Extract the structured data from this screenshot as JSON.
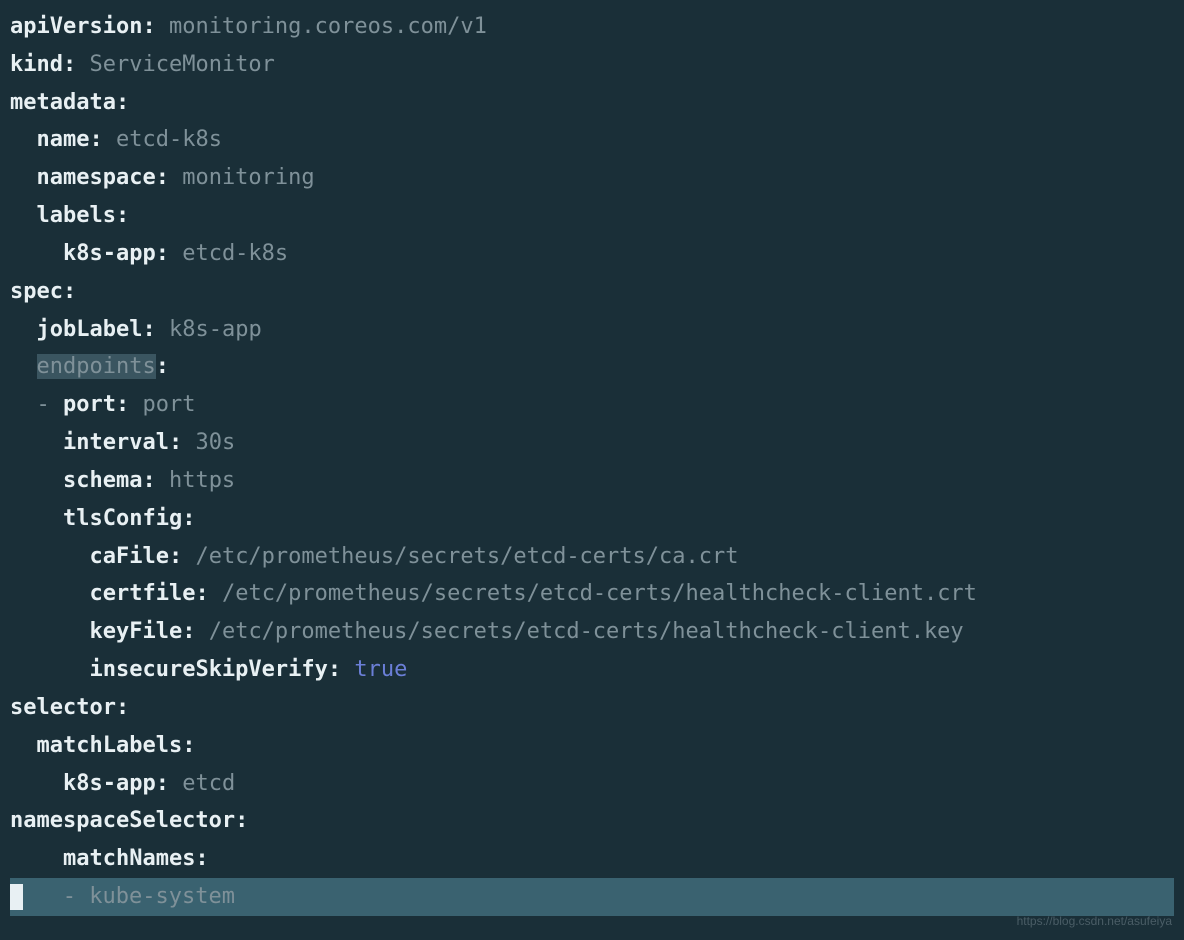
{
  "lines": {
    "l1_key": "apiVersion:",
    "l1_val": "monitoring.coreos.com/v1",
    "l2_key": "kind:",
    "l2_val": "ServiceMonitor",
    "l3_key": "metadata:",
    "l4_key": "name:",
    "l4_val": "etcd-k8s",
    "l5_key": "namespace:",
    "l5_val": "monitoring",
    "l6_key": "labels:",
    "l7_key": "k8s-app:",
    "l7_val": "etcd-k8s",
    "l8_key": "spec:",
    "l9_key": "jobLabel:",
    "l9_val": "k8s-app",
    "l10_hl": "endpoints",
    "l10_colon": ":",
    "l11_dash": "-",
    "l11_key": "port:",
    "l11_val": "port",
    "l12_key": "interval:",
    "l12_val": "30s",
    "l13_key": "schema:",
    "l13_val": "https",
    "l14_key": "tlsConfig:",
    "l15_key": "caFile:",
    "l15_val": "/etc/prometheus/secrets/etcd-certs/ca.crt",
    "l16_key": "certfile:",
    "l16_val": "/etc/prometheus/secrets/etcd-certs/healthcheck-client.crt",
    "l17_key": "keyFile:",
    "l17_val": "/etc/prometheus/secrets/etcd-certs/healthcheck-client.key",
    "l18_key": "insecureSkipVerify:",
    "l18_val": "true",
    "l19_key": "selector:",
    "l20_key": "matchLabels:",
    "l21_key": "k8s-app:",
    "l21_val": "etcd",
    "l22_key": "namespaceSelector:",
    "l23_key": "matchNames:",
    "l24_dash": "-",
    "l24_val": "kube-system"
  },
  "watermark": "https://blog.csdn.net/asufeiya"
}
